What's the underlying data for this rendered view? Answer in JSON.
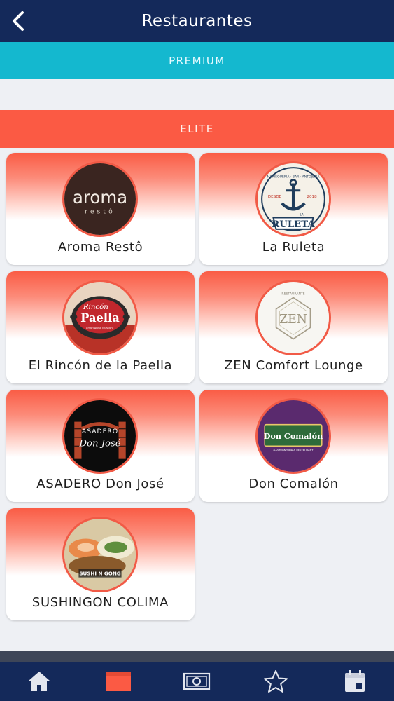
{
  "header": {
    "title": "Restaurantes",
    "back_icon": "chevron-left-icon"
  },
  "sections": {
    "premium": {
      "label": "PREMIUM",
      "color": "#14b8cf"
    },
    "elite": {
      "label": "ELITE",
      "color": "#fb5a44"
    }
  },
  "restaurants": [
    {
      "name": "Aroma Restô",
      "logo_text": "aroma",
      "logo_sub": "restô"
    },
    {
      "name": "La Ruleta",
      "logo_text": "RULETA",
      "logo_small": "LA",
      "logo_year_left": "DESDE",
      "logo_year_right": "2018",
      "logo_top": "MARISQUERÍA · BAR · ANTOJERÍA"
    },
    {
      "name": "El Rincón de la Paella",
      "logo_text": "Paella",
      "logo_small": "Rincón",
      "logo_sub": "CON SABOR ESPAÑOL"
    },
    {
      "name": "ZEN Comfort Lounge",
      "logo_text": "ZEN",
      "logo_top": "RESTAURANTE"
    },
    {
      "name": "ASADERO Don José",
      "logo_text": "Don José",
      "logo_small": "ASADERO"
    },
    {
      "name": "Don Comalón",
      "logo_text": "Don Comalón",
      "logo_sub": "GASTRONOMÍA & RESTAURANT"
    },
    {
      "name": "SUSHINGON COLIMA",
      "logo_text": "SUSHI N GONG"
    }
  ],
  "bottom_nav": [
    {
      "icon": "home-icon",
      "active": false
    },
    {
      "icon": "store-icon",
      "active": true
    },
    {
      "icon": "money-icon",
      "active": false
    },
    {
      "icon": "star-icon",
      "active": false
    },
    {
      "icon": "calendar-icon",
      "active": false
    }
  ],
  "colors": {
    "header": "#14295a",
    "accent": "#fb5a44",
    "premium": "#14b8cf"
  }
}
